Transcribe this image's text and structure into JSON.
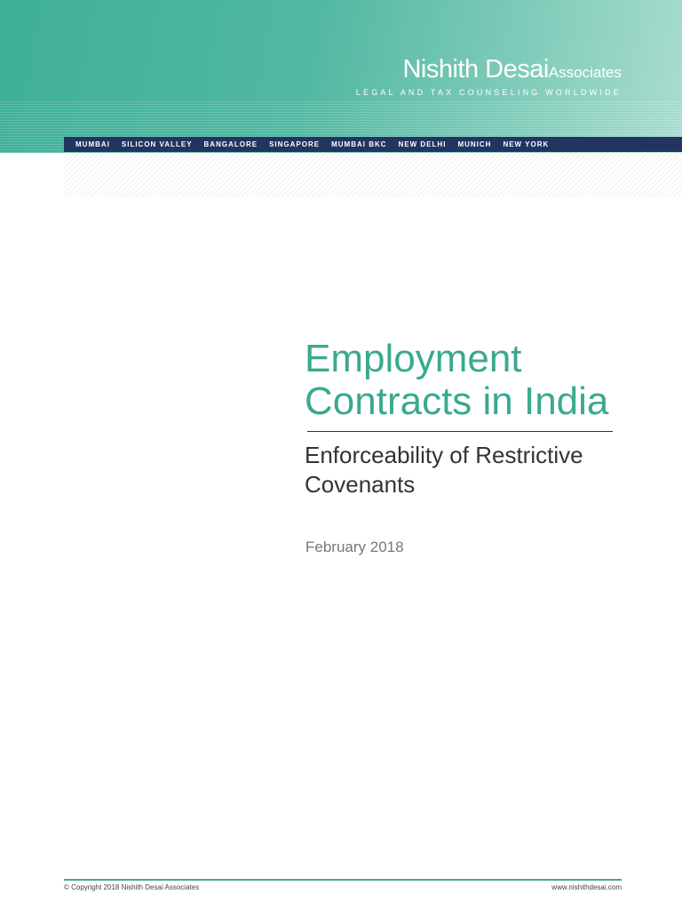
{
  "header": {
    "logo_name": "Nishith Desai",
    "logo_suffix": "Associates",
    "tagline": "LEGAL AND TAX COUNSELING WORLDWIDE",
    "offices": [
      "MUMBAI",
      "SILICON VALLEY",
      "BANGALORE",
      "SINGAPORE",
      "MUMBAI BKC",
      "NEW DELHI",
      "MUNICH",
      "NEW YORK"
    ]
  },
  "document": {
    "title_line1": "Employment",
    "title_line2": "Contracts in India",
    "subtitle_line1": "Enforceability of Restrictive",
    "subtitle_line2": "Covenants",
    "date": "February 2018"
  },
  "footer": {
    "copyright": "© Copyright 2018 Nishith Desai Associates",
    "website": "www.nishithdesai.com"
  }
}
